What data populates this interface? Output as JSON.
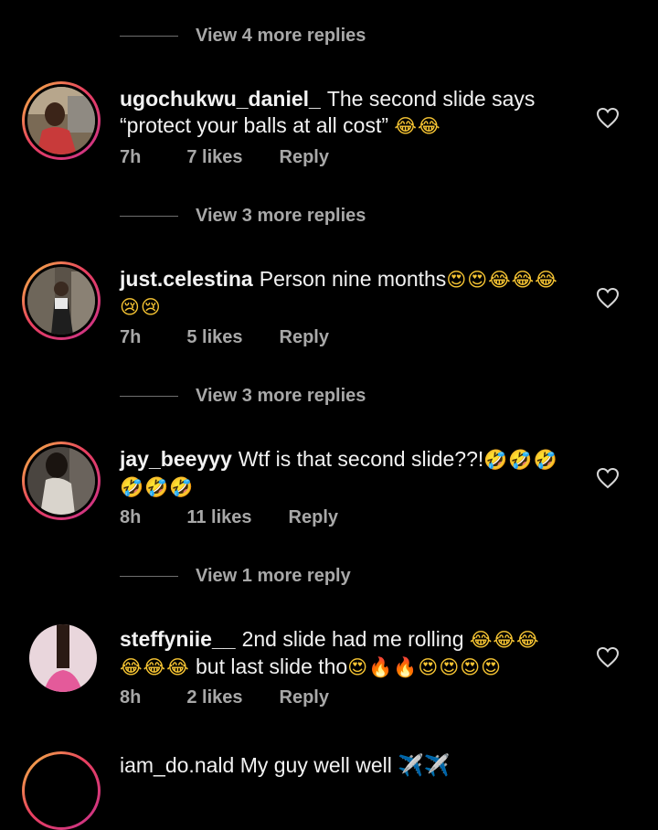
{
  "colors": {
    "background": "#000000",
    "text": "#f2f2f2",
    "muted": "#a8a8a8",
    "ring_start": "#f6c343",
    "ring_end": "#c8328c"
  },
  "replies_top": "View 4 more replies",
  "comments": [
    {
      "username": "ugochukwu_daniel_",
      "text": "The second slide says “protect your balls at all cost”",
      "emoji": "😂😂",
      "time": "7h",
      "likes": "7 likes",
      "reply": "Reply",
      "view_replies": "View 3 more replies",
      "icon": "heart-outline-icon"
    },
    {
      "username": "just.celestina",
      "text": "Person nine months",
      "emoji": "😍😍😂😂😂😢😢",
      "time": "7h",
      "likes": "5 likes",
      "reply": "Reply",
      "view_replies": "View 3 more replies",
      "icon": "heart-outline-icon"
    },
    {
      "username": "jay_beeyyy",
      "text": "Wtf is that second slide??!",
      "emoji": "🤣🤣🤣🤣🤣🤣",
      "time": "8h",
      "likes": "11 likes",
      "reply": "Reply",
      "view_replies": "View 1 more reply",
      "icon": "heart-outline-icon"
    },
    {
      "username": "steffyniie__",
      "text": "2nd slide had me rolling",
      "emoji": "😂😂😂",
      "text2": "but last slide tho",
      "emoji2": "😂😂😂",
      "emoji3": "😍🔥🔥😍😍😍😍",
      "time": "8h",
      "likes": "2 likes",
      "reply": "Reply",
      "icon": "heart-outline-icon"
    }
  ],
  "partial_comment": "iam_do.nald My guy well well ✈️✈️"
}
